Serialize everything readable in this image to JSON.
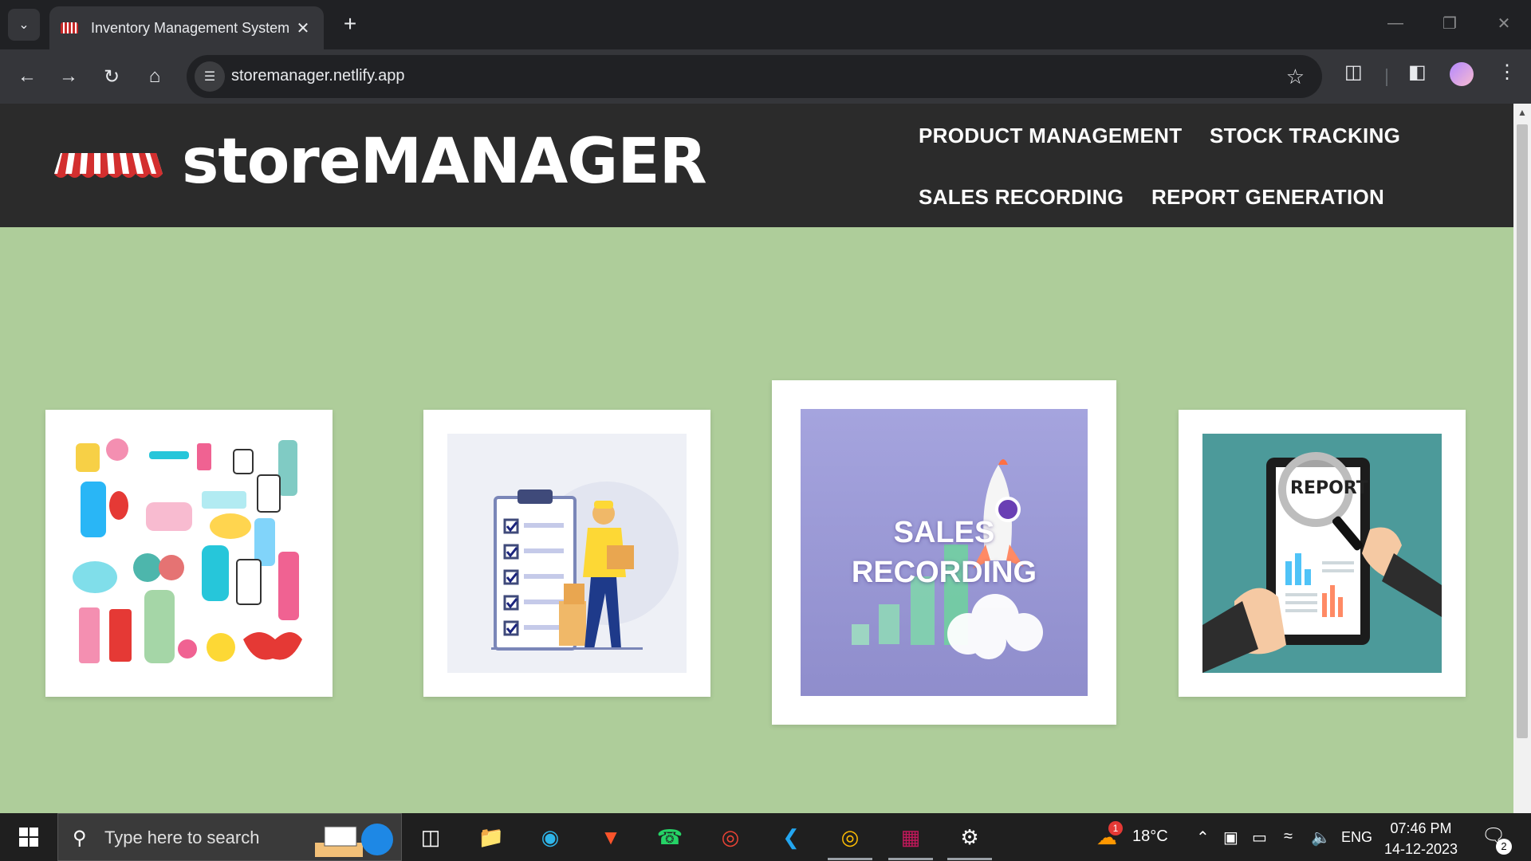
{
  "browser": {
    "tab_title": "Inventory Management System",
    "url": "storemanager.netlify.app"
  },
  "site": {
    "brand": "storeMANAGER",
    "nav": [
      {
        "label": "PRODUCT MANAGEMENT"
      },
      {
        "label": "STOCK TRACKING"
      },
      {
        "label": "SALES RECORDING"
      },
      {
        "label": "REPORT GENERATION"
      }
    ],
    "cards": [
      {
        "icon": "cosmetics-products-illustration"
      },
      {
        "icon": "stock-checklist-illustration"
      },
      {
        "icon": "rocket-growth-illustration",
        "caption_line1": "SALES",
        "caption_line2": "RECORDING"
      },
      {
        "icon": "report-tablet-illustration",
        "report_label": "REPORT"
      }
    ],
    "colors": {
      "page_bg": "#aecd9a",
      "header_bg": "#2b2b2b",
      "card_bg": "#ffffff"
    }
  },
  "taskbar": {
    "search_placeholder": "Type here to search",
    "weather_temp": "18°C",
    "weather_badge": "1",
    "language": "ENG",
    "time": "07:46 PM",
    "date": "14-12-2023",
    "notification_count": "2"
  }
}
